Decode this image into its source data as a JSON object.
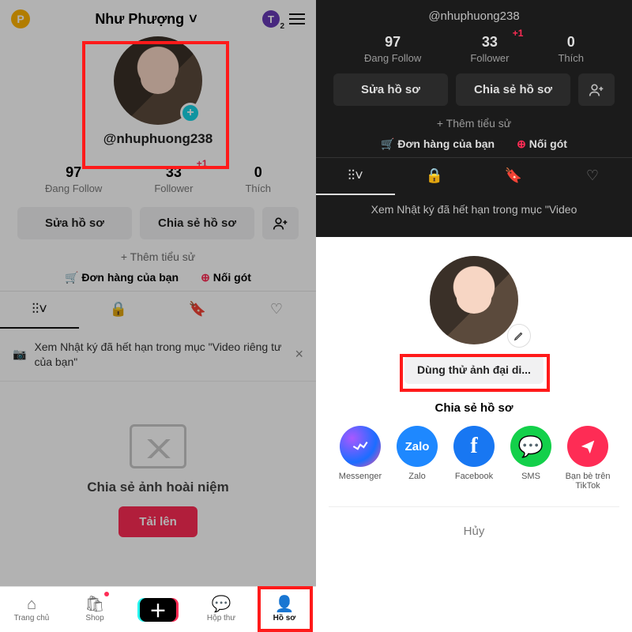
{
  "left": {
    "header": {
      "badge": "P",
      "title": "Như Phượng",
      "t_badge": "T",
      "t_sub": "2"
    },
    "username": "@nhuphuong238",
    "stats": [
      {
        "num": "97",
        "lbl": "Đang Follow",
        "plus": ""
      },
      {
        "num": "33",
        "lbl": "Follower",
        "plus": "+1"
      },
      {
        "num": "0",
        "lbl": "Thích",
        "plus": ""
      }
    ],
    "buttons": {
      "edit": "Sửa hồ sơ",
      "share": "Chia sẻ hồ sơ"
    },
    "add_bio": "+ Thêm tiểu sử",
    "orders": "Đơn hàng của bạn",
    "follow_camera": "Nối gót",
    "notice": "Xem Nhật ký đã hết hạn trong mục \"Video riêng tư của bạn\"",
    "empty_title": "Chia sẻ ảnh hoài niệm",
    "upload": "Tải lên",
    "nav": [
      "Trang chủ",
      "Shop",
      "",
      "Hộp thư",
      "Hồ sơ"
    ]
  },
  "right": {
    "username": "@nhuphuong238",
    "stats": [
      {
        "num": "97",
        "lbl": "Đang Follow",
        "plus": ""
      },
      {
        "num": "33",
        "lbl": "Follower",
        "plus": "+1"
      },
      {
        "num": "0",
        "lbl": "Thích",
        "plus": ""
      }
    ],
    "buttons": {
      "edit": "Sửa hồ sơ",
      "share": "Chia sẻ hồ sơ"
    },
    "add_bio": "+ Thêm tiểu sử",
    "orders": "Đơn hàng của bạn",
    "follow_camera": "Nối gót",
    "glimpse": "Xem Nhật ký đã hết hạn trong mục \"Video",
    "sheet": {
      "try_avatar": "Dùng thử ảnh đại di...",
      "share_title": "Chia sẻ hồ sơ",
      "options": [
        {
          "name": "Messenger"
        },
        {
          "name": "Zalo"
        },
        {
          "name": "Facebook"
        },
        {
          "name": "SMS"
        },
        {
          "name": "Bạn bè trên TikTok"
        }
      ],
      "cancel": "Hủy"
    }
  }
}
